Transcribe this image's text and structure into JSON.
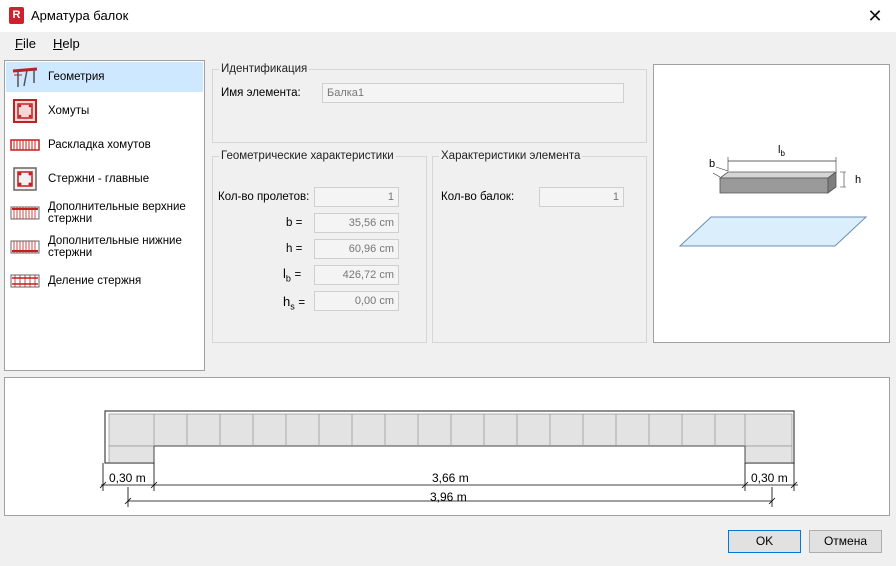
{
  "window": {
    "title": "Арматура балок",
    "app_icon_letter": "R",
    "close_glyph": "✕"
  },
  "menu": [
    {
      "label": "File",
      "mnemonic": "F",
      "rest": "ile"
    },
    {
      "label": "Help",
      "mnemonic": "H",
      "rest": "elp"
    }
  ],
  "nav": {
    "items": [
      {
        "label": "Геометрия",
        "icon": "geometry-icon",
        "selected": true
      },
      {
        "label": "Хомуты",
        "icon": "stirrups-icon"
      },
      {
        "label": "Раскладка хомутов",
        "icon": "stirrup-layout-icon"
      },
      {
        "label": "Стержни - главные",
        "icon": "main-bars-icon"
      },
      {
        "label": "Дополнительные верхние стержни",
        "icon": "top-bars-icon"
      },
      {
        "label": "Дополнительные нижние стержни",
        "icon": "bottom-bars-icon"
      },
      {
        "label": "Деление стержня",
        "icon": "bar-split-icon"
      }
    ]
  },
  "identification": {
    "legend": "Идентификация",
    "element_name_label": "Имя элемента:",
    "element_name_value": "Балка1"
  },
  "geometry": {
    "legend": "Геометрические характеристики",
    "spans_label": "Кол-во пролетов:",
    "spans_value": "1",
    "b_label": "b =",
    "b_value": "35,56 cm",
    "h_label": "h =",
    "h_value": "60,96 cm",
    "lb_main": "l",
    "lb_sub": "b",
    "lb_eq": "=",
    "lb_value": "426,72 cm",
    "hs_main": "h",
    "hs_sub": "s",
    "hs_eq": "=",
    "hs_value": "0,00 cm"
  },
  "element_props": {
    "legend": "Характеристики элемента",
    "beams_label": "Кол-во балок:",
    "beams_value": "1"
  },
  "preview": {
    "lb_main": "l",
    "lb_sub": "b",
    "b_label": "b",
    "h_label": "h"
  },
  "elevation": {
    "left_support": "0,30 m",
    "span": "3,66 m",
    "right_support": "0,30 m",
    "total": "3,96 m"
  },
  "buttons": {
    "ok": "OK",
    "cancel": "Отмена"
  }
}
